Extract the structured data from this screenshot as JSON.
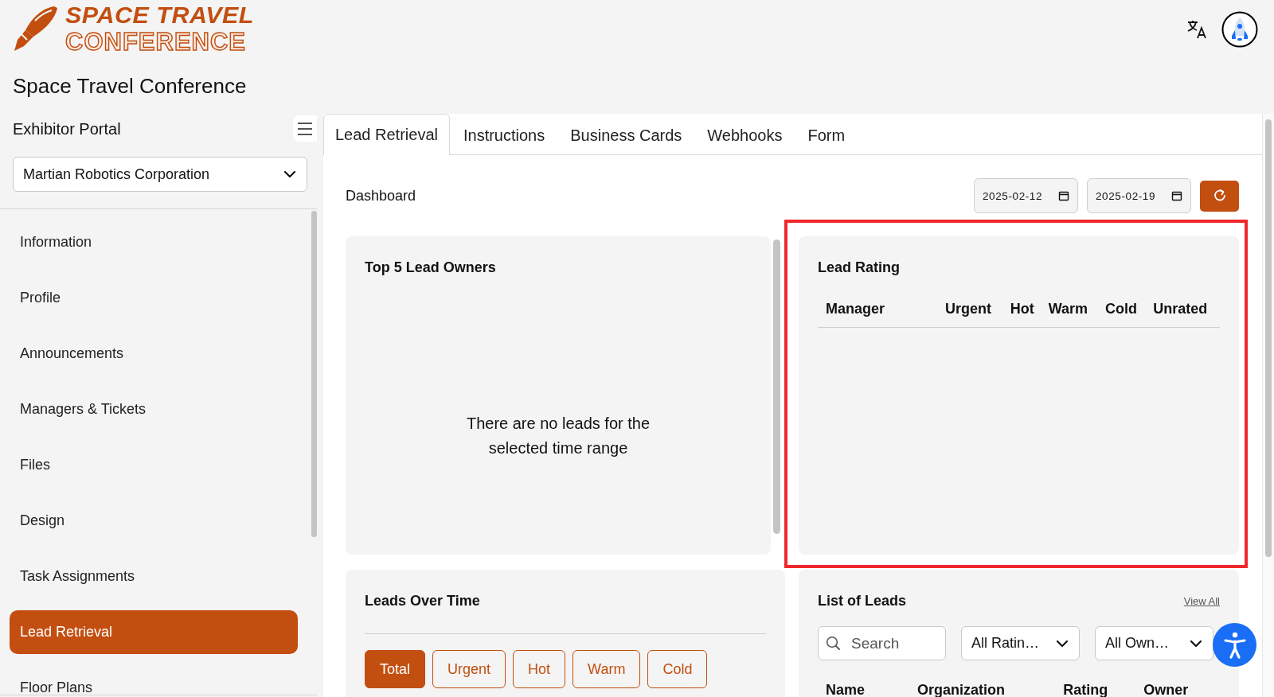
{
  "logo": {
    "line_1": "SPACE TRAVEL",
    "line_2": "CONFERENCE"
  },
  "header": {
    "title": "Space Travel Conference"
  },
  "sidebar": {
    "heading": "Exhibitor Portal",
    "exhibitor_select": {
      "value": "Martian Robotics Corporation"
    },
    "items": [
      {
        "label": "Information",
        "selected": false
      },
      {
        "label": "Profile",
        "selected": false
      },
      {
        "label": "Announcements",
        "selected": false
      },
      {
        "label": "Managers & Tickets",
        "selected": false
      },
      {
        "label": "Files",
        "selected": false
      },
      {
        "label": "Design",
        "selected": false
      },
      {
        "label": "Task Assignments",
        "selected": false
      },
      {
        "label": "Lead Retrieval",
        "selected": true
      },
      {
        "label": "Floor Plans",
        "selected": false
      }
    ]
  },
  "tabs": [
    {
      "label": "Lead Retrieval",
      "selected": true
    },
    {
      "label": "Instructions",
      "selected": false
    },
    {
      "label": "Business Cards",
      "selected": false
    },
    {
      "label": "Webhooks",
      "selected": false
    },
    {
      "label": "Form",
      "selected": false
    }
  ],
  "dashboard": {
    "title": "Dashboard",
    "date_from": "2025-02-12",
    "date_to": "2025-02-19"
  },
  "top_lead_owners": {
    "title": "Top 5 Lead Owners",
    "empty_message": "There are no leads for the selected time range"
  },
  "lead_rating": {
    "title": "Lead Rating",
    "highlighted": true,
    "columns": [
      "Manager",
      "Urgent",
      "Hot",
      "Warm",
      "Cold",
      "Unrated"
    ]
  },
  "leads_over_time": {
    "title": "Leads Over Time",
    "filters": [
      {
        "label": "Total",
        "selected": true
      },
      {
        "label": "Urgent",
        "selected": false
      },
      {
        "label": "Hot",
        "selected": false
      },
      {
        "label": "Warm",
        "selected": false
      },
      {
        "label": "Cold",
        "selected": false
      }
    ]
  },
  "list_of_leads": {
    "title": "List of Leads",
    "view_all": "View All",
    "search": {
      "placeholder": "Search"
    },
    "rating_filter": {
      "value": "All Ratin…"
    },
    "owner_filter": {
      "value": "All Own…"
    },
    "columns": [
      "Name",
      "Organization",
      "Rating",
      "Owner"
    ]
  }
}
